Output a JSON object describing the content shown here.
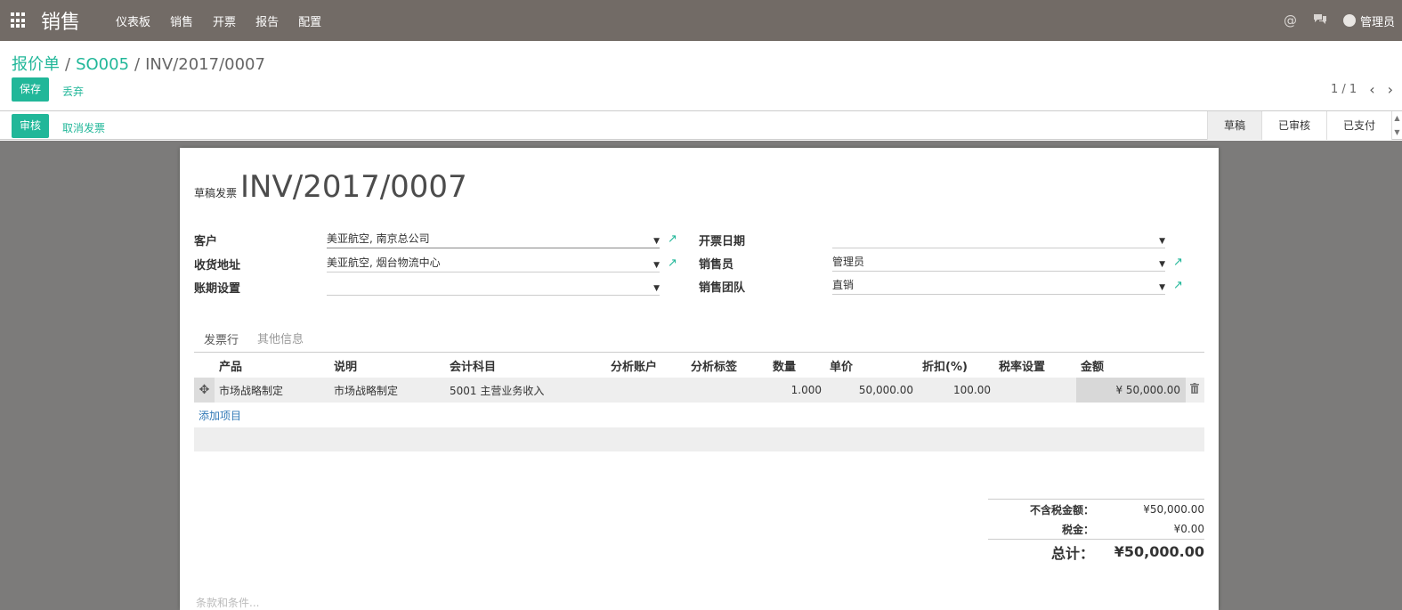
{
  "navbar": {
    "app_title": "销售",
    "menu": [
      "仪表板",
      "销售",
      "开票",
      "报告",
      "配置"
    ],
    "user": "管理员",
    "icons": [
      "apps-grid-icon",
      "at-icon",
      "chat-icon"
    ]
  },
  "breadcrumb": {
    "item1": "报价单",
    "sep1": "/",
    "item2": "SO005",
    "sep2": "/",
    "current": "INV/2017/0007"
  },
  "actions": {
    "save": "保存",
    "discard": "丢弃",
    "review": "审核",
    "cancel_invoice": "取消发票"
  },
  "pager": {
    "value": "1 / 1",
    "prev": "<",
    "next": ">"
  },
  "statusbar": {
    "stages": [
      "草稿",
      "已审核",
      "已支付"
    ],
    "active_stage": "草稿"
  },
  "form": {
    "title_label": "草稿发票",
    "title_number": "INV/2017/0007",
    "customer_label": "客户",
    "customer_value": "美亚航空, 南京总公司",
    "delivery_label": "收货地址",
    "delivery_value": "美亚航空, 烟台物流中心",
    "payment_terms_label": "账期设置",
    "payment_terms_value": "",
    "invoice_date_label": "开票日期",
    "invoice_date_value": "",
    "salesperson_label": "销售员",
    "salesperson_value": "管理员",
    "sales_team_label": "销售团队",
    "sales_team_value": "直销"
  },
  "tabs": [
    "发票行",
    "其他信息"
  ],
  "table": {
    "headers": [
      "产品",
      "说明",
      "会计科目",
      "分析账户",
      "分析标签",
      "数量",
      "单价",
      "折扣(%)",
      "税率设置",
      "金额"
    ],
    "rows": [
      {
        "product": "市场战略制定",
        "description": "市场战略制定",
        "account": "5001 主营业务收入",
        "analytic_account": "",
        "analytic_tags": "",
        "quantity": "1.000",
        "unit_price": "50,000.00",
        "discount": "100.00",
        "taxes": "",
        "amount": "¥ 50,000.00"
      }
    ],
    "add_line": "添加项目"
  },
  "totals": {
    "untaxed_label": "不含税金额：",
    "untaxed_value": "¥50,000.00",
    "tax_label": "税金：",
    "tax_value": "¥0.00",
    "total_label": "总计：",
    "total_value": "¥50,000.00"
  },
  "terms_placeholder": "条款和条件..."
}
